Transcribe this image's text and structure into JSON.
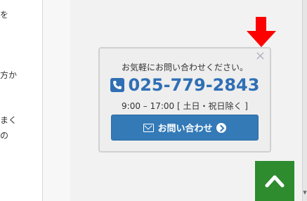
{
  "left_fragments": [
    "を",
    "方か",
    "まく",
    "の"
  ],
  "popup": {
    "close_glyph": "×",
    "message": "お気軽にお問い合わせください。",
    "phone": "025-779-2843",
    "hours": "9:00 – 17:00 [ 土日・祝日除く ]",
    "button_label": "お問い合わせ"
  },
  "icons": {
    "phone": "phone-square-icon",
    "mail": "envelope-icon",
    "arrow": "arrow-circle-right-icon",
    "pointer": "red-down-arrow-icon",
    "top": "chevron-up-icon"
  },
  "colors": {
    "accent_blue": "#337ab7",
    "phone_text": "#2f6fb5",
    "top_button": "#2e8b2e",
    "pointer_red": "#ff0000"
  }
}
